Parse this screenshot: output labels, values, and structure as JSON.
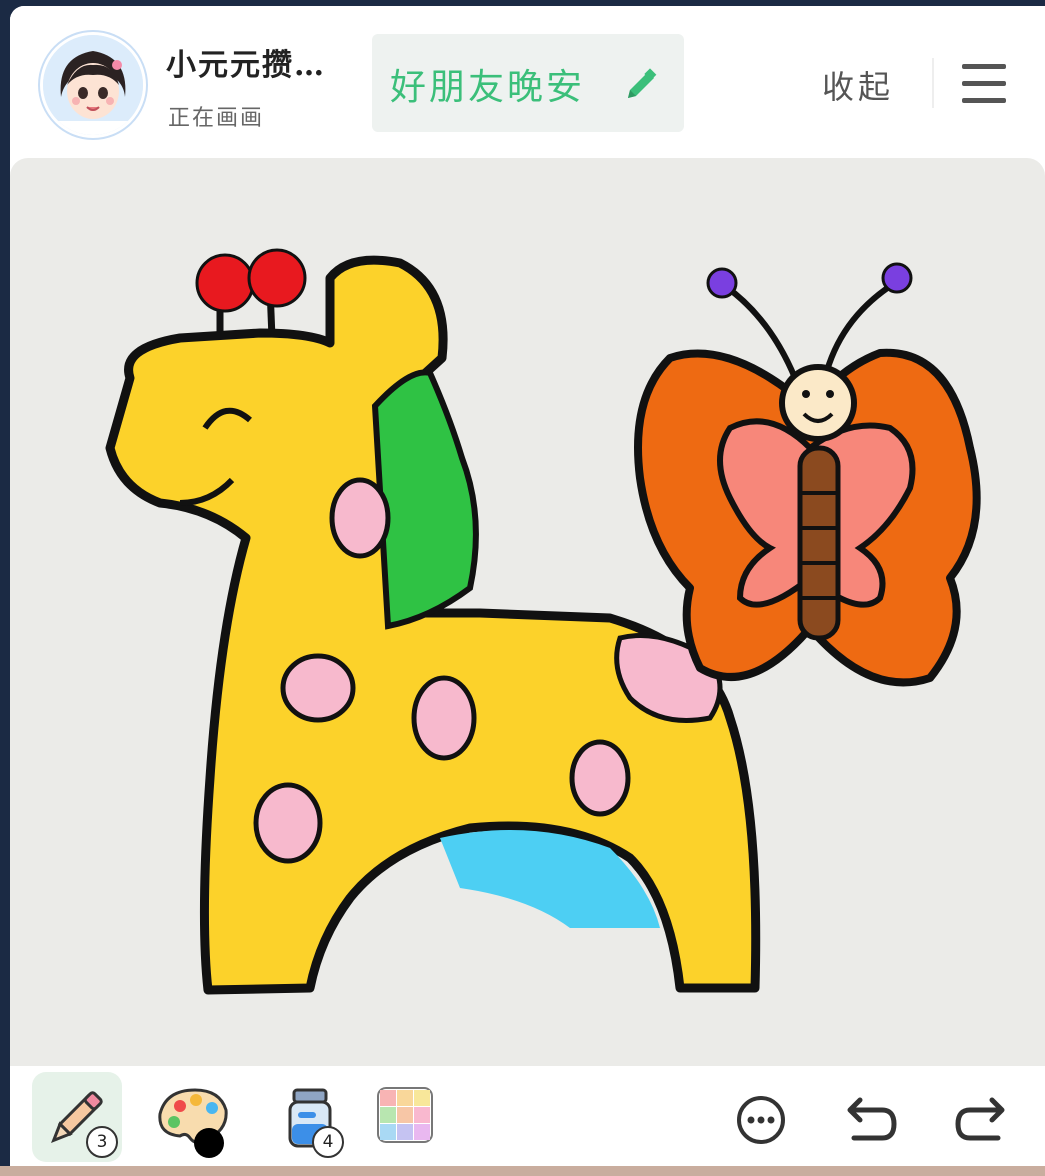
{
  "header": {
    "username": "小元元攒…",
    "status": "正在画画",
    "title": "好朋友晚安",
    "collapse_label": "收起"
  },
  "toolbar": {
    "pen_badge": "3",
    "fill_badge": "4"
  },
  "colors": {
    "accent": "#3bbf7a",
    "canvas_bg": "#ebebe8",
    "selected_color": "#000000"
  },
  "icons": [
    "edit-pencil-icon",
    "menu-icon",
    "pencil-icon",
    "palette-icon",
    "paint-bucket-icon",
    "color-grid-icon",
    "more-icon",
    "undo-icon",
    "redo-icon"
  ]
}
